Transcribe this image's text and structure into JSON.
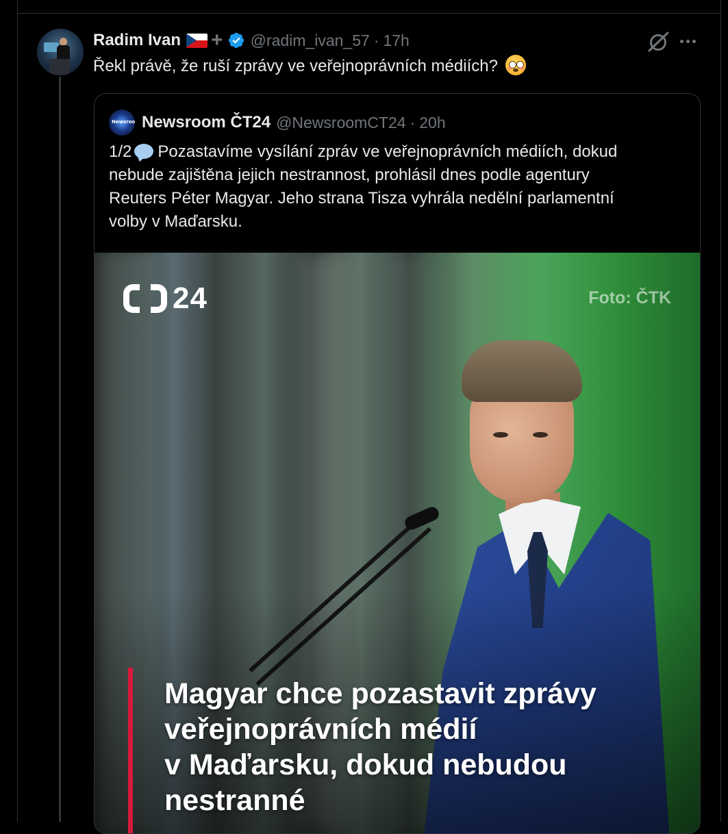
{
  "post": {
    "display_name": "Radim Ivan",
    "handle": "@radim_ivan_57",
    "separator": "·",
    "time": "17h",
    "text": "Řekl právě, že ruší zprávy ve veřejnoprávních médiích?"
  },
  "quoted_post": {
    "display_name": "Newsroom ČT24",
    "handle": "@NewsroomCT24",
    "separator": "·",
    "time": "20h",
    "avatar_text": "Newsroom ČT24",
    "text_lines": [
      {
        "prefix": "1/2",
        "rest": "Pozastavíme vysílání zpráv ve veřejnoprávních médiích, dokud"
      },
      "nebude zajištěna jejich nestrannost, prohlásil dnes podle agentury",
      "Reuters Péter Magyar. Jeho strana Tisza vyhrála nedělní parlamentní",
      "volby v Maďarsku."
    ],
    "image": {
      "logo_number": "24",
      "photo_credit": "Foto: ČTK",
      "headline_lines": [
        "Magyar chce pozastavit zprávy",
        "veřejnoprávních médií",
        "v Maďarsku, dokud nebudou",
        "nestranné"
      ]
    }
  },
  "icons": {
    "flag": "czech-flag-icon",
    "verified": "verified-badge-icon",
    "grok": "grok-icon",
    "more": "more-icon",
    "emoji": "flushed-face-icon",
    "speech": "speech-balloon-icon"
  },
  "colors": {
    "background": "#000000",
    "text": "#e7e9ea",
    "muted": "#71767b",
    "verified": "#1d9bf0",
    "headline_accent": "#d71a3a"
  }
}
